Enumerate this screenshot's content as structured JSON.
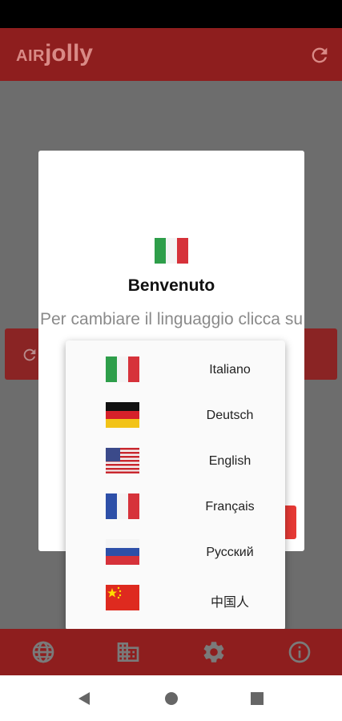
{
  "app": {
    "title_prefix": "AIR",
    "title_main": "jolly"
  },
  "dialog": {
    "title": "Benvenuto",
    "text": "Per cambiare il linguaggio clicca su"
  },
  "languages": [
    {
      "flag": "italy",
      "label": "Italiano"
    },
    {
      "flag": "germany",
      "label": "Deutsch"
    },
    {
      "flag": "usa",
      "label": "English"
    },
    {
      "flag": "france",
      "label": "Français"
    },
    {
      "flag": "russia",
      "label": "Русский"
    },
    {
      "flag": "china",
      "label": "中国人"
    }
  ],
  "bottom_nav": [
    "globe-icon",
    "building-icon",
    "gear-icon",
    "info-icon"
  ],
  "colors": {
    "app_bar": "#8e1e1e",
    "app_title": "#d98a86",
    "overlay": "#6d6d6d",
    "accent_red": "#e53935",
    "menu_bg": "#fafafa"
  }
}
